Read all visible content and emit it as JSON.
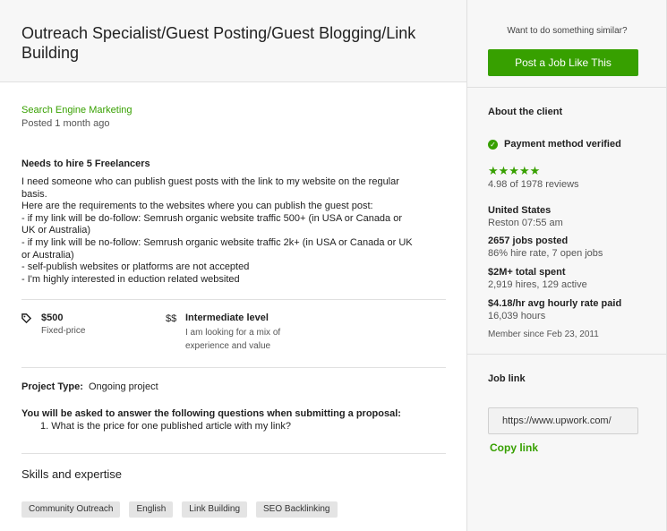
{
  "job": {
    "title": "Outreach Specialist/Guest Posting/Guest Blogging/Link Building",
    "category": "Search Engine Marketing",
    "posted": "Posted 1 month ago",
    "hire_title": "Needs to hire 5 Freelancers",
    "description_lines": [
      "I need someone who can publish guest posts with the link to my website on the regular",
      "basis.",
      "Here are the requirements to the websites where you can publish the guest post:",
      "- if my link will be do-follow: Semrush organic website traffic 500+ (in USA or Canada or",
      "UK or Australia)",
      "- if my link will be no-follow: Semrush organic website traffic 2k+ (in USA or Canada or UK",
      "or Australia)",
      "- self-publish websites or platforms are not accepted",
      "- I'm highly interested in eduction related websited"
    ],
    "price": {
      "icon": "tag-icon",
      "amount": "$500",
      "type": "Fixed-price"
    },
    "level": {
      "icon": "dollar-level-icon",
      "icon_text": "$$",
      "title": "Intermediate level",
      "description": "I am looking for a mix of experience and value"
    },
    "project_type_label": "Project Type:",
    "project_type_value": "Ongoing project",
    "questions_title": "You will be asked to answer the following questions when submitting a proposal:",
    "questions": [
      "1. What is the price for one published article with my link?"
    ],
    "skills_title": "Skills and expertise",
    "skills": [
      "Community Outreach",
      "English",
      "Link Building",
      "SEO Backlinking"
    ]
  },
  "sidebar": {
    "want_text": "Want to do something similar?",
    "post_button": "Post a Job Like This",
    "about_title": "About the client",
    "verified_text": "Payment method verified",
    "stars": "★★★★★",
    "rating": 4.98,
    "reviews": "4.98 of 1978 reviews",
    "location_country": "United States",
    "location_city": "Reston 07:55 am",
    "jobs_posted": "2657 jobs posted",
    "hire_rate": "86% hire rate, 7 open jobs",
    "total_spent": "$2M+ total spent",
    "hires": "2,919 hires, 129 active",
    "avg_rate": "$4.18/hr avg hourly rate paid",
    "hours": "16,039 hours",
    "member_since": "Member since Feb 23, 2011",
    "job_link_title": "Job link",
    "job_link_url": "https://www.upwork.com/",
    "copy_link": "Copy link"
  },
  "colors": {
    "accent": "#37a000",
    "panel_bg": "#f7f7f7",
    "border": "#e0e0e0",
    "skill_bg": "#e4e4e4"
  }
}
